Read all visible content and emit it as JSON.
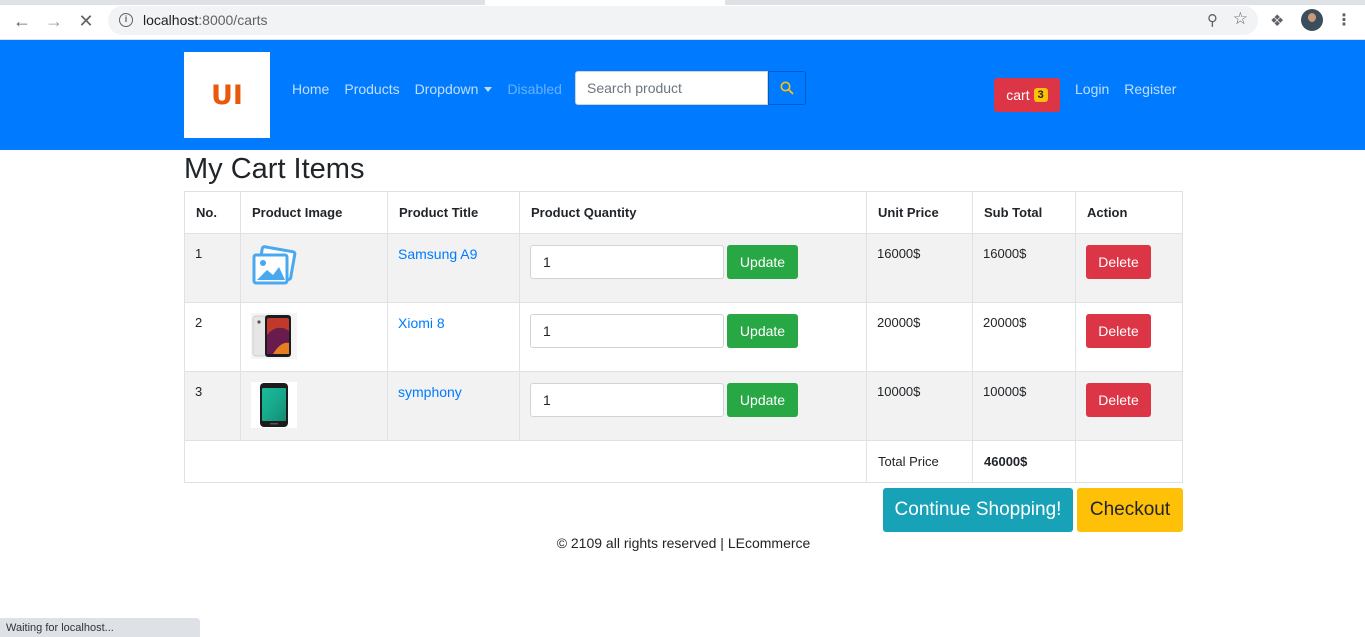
{
  "browser": {
    "url_host": "localhost",
    "url_path": ":8000/carts",
    "status_text": "Waiting for localhost..."
  },
  "navbar": {
    "logo_text": "UI",
    "links": [
      "Home",
      "Products",
      "Dropdown",
      "Disabled"
    ],
    "search_placeholder": "Search product",
    "cart_label": "cart",
    "cart_count": "3",
    "login": "Login",
    "register": "Register",
    "brand_color": "#007bff"
  },
  "cart": {
    "title": "My Cart Items",
    "headers": [
      "No.",
      "Product Image",
      "Product Title",
      "Product Quantity",
      "Unit Price",
      "Sub Total",
      "Action"
    ],
    "rows": [
      {
        "no": "1",
        "title": "Samsung A9",
        "quantity": "1",
        "unit_price": "16000$",
        "sub_total": "16000$",
        "image": "placeholder-image-icon"
      },
      {
        "no": "2",
        "title": "Xiomi 8",
        "quantity": "1",
        "unit_price": "20000$",
        "sub_total": "20000$",
        "image": "phone-photo"
      },
      {
        "no": "3",
        "title": "symphony",
        "quantity": "1",
        "unit_price": "10000$",
        "sub_total": "10000$",
        "image": "phone-photo"
      }
    ],
    "update_label": "Update",
    "delete_label": "Delete",
    "total_label": "Total Price",
    "total_value": "46000$"
  },
  "actions": {
    "continue": "Continue Shopping!",
    "checkout": "Checkout"
  },
  "footer": "© 2109 all rights reserved | LEcommerce"
}
